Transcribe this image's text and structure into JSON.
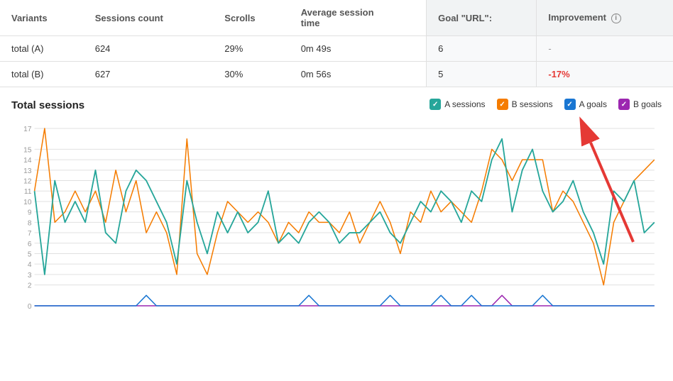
{
  "table": {
    "headers": {
      "variants": "Variants",
      "sessions_count": "Sessions count",
      "scrolls": "Scrolls",
      "avg_session_time": "Average session time",
      "goal_url": "Goal \"URL\":",
      "improvement": "Improvement"
    },
    "rows": [
      {
        "variant": "total (A)",
        "sessions": "624",
        "scrolls": "29%",
        "avg_time": "0m 49s",
        "goal": "6",
        "improvement": "-",
        "improvement_type": "dash"
      },
      {
        "variant": "total (B)",
        "sessions": "627",
        "scrolls": "30%",
        "avg_time": "0m 56s",
        "goal": "5",
        "improvement": "-17%",
        "improvement_type": "negative"
      }
    ]
  },
  "chart": {
    "title": "Total sessions",
    "legend": [
      {
        "label": "A sessions",
        "color": "#26a69a",
        "type": "check"
      },
      {
        "label": "B sessions",
        "color": "#f57c00",
        "type": "check"
      },
      {
        "label": "A goals",
        "color": "#1976d2",
        "type": "check"
      },
      {
        "label": "B goals",
        "color": "#9c27b0",
        "type": "check"
      }
    ],
    "y_labels": [
      "0",
      "2",
      "3",
      "4",
      "5",
      "6",
      "7",
      "8",
      "9",
      "10",
      "11",
      "12",
      "13",
      "14",
      "15",
      "17"
    ],
    "y_ticks": [
      0,
      2,
      3,
      4,
      5,
      6,
      7,
      8,
      9,
      10,
      11,
      12,
      13,
      14,
      15,
      17
    ]
  },
  "annotation": {
    "value": "-17%"
  }
}
